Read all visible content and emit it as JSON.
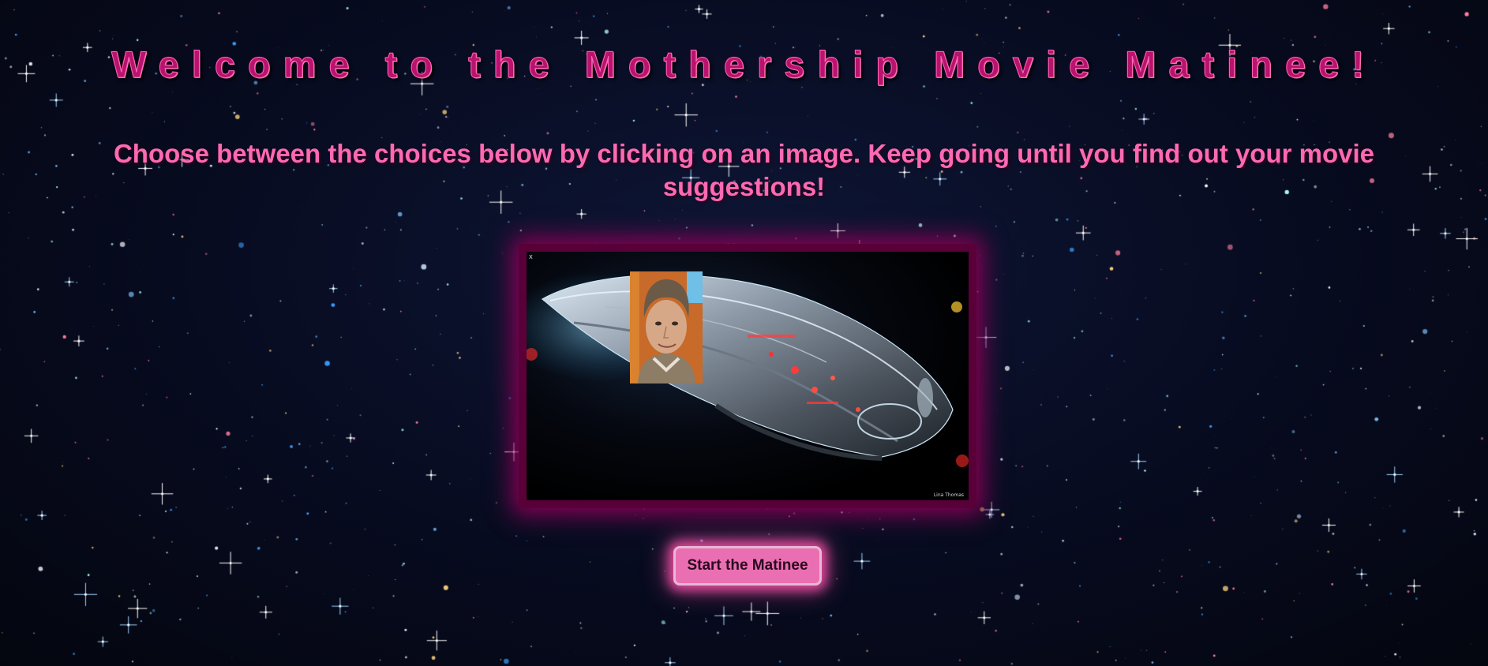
{
  "header": {
    "title": "Welcome to the Mothership Movie Matinee!",
    "instructions": "Choose between the choices below by clicking on an image. Keep going until you find out your movie suggestions!"
  },
  "choice_image": {
    "watermark_line1": "X",
    "watermark_line2": "",
    "credit": "Lina Thomas"
  },
  "actions": {
    "start_label": "Start the Matinee"
  },
  "colors": {
    "title": "#b8146f",
    "subtitle": "#ff69b4",
    "frame_glow": "#8a0057",
    "button_bg": "#ea6fb2"
  }
}
